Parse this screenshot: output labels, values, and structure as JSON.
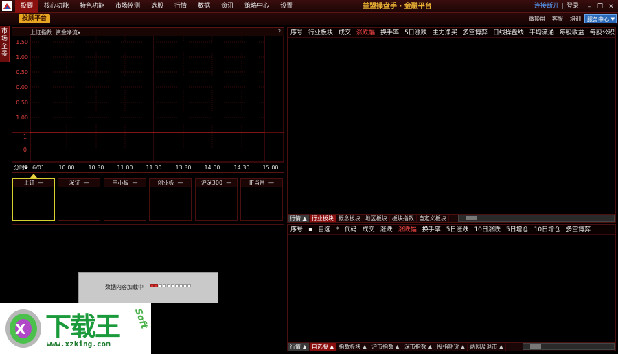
{
  "menu": {
    "items": [
      "投顾",
      "核心功能",
      "特色功能",
      "市场监测",
      "选股",
      "行情",
      "数据",
      "资讯",
      "策略中心",
      "设置"
    ],
    "active_index": 0
  },
  "brand": "益盟操盘手 · 金融平台",
  "top_links": {
    "connect": "连接断开",
    "sep": "|",
    "login": "登录"
  },
  "window_buttons": {
    "minimize": "–",
    "restore": "❐",
    "close": "✕"
  },
  "subbar": {
    "tab": "投顾平台",
    "links": [
      "微操盘",
      "客服",
      "培训"
    ],
    "service": "服务中心",
    "service_arrow": "▼"
  },
  "vertical_label": "市场全景",
  "chart_panel": {
    "index_name": "上证指数",
    "flow_selector": "资金净流▾",
    "help": "?",
    "period_label": "分时",
    "date": "6/01",
    "time_ticks": [
      "10:00",
      "10:30",
      "11:00",
      "11:30",
      "13:30",
      "14:00",
      "14:30",
      "15:00"
    ],
    "y_ticks_upper": [
      "1.50",
      "1.00",
      "0.50",
      "0.00",
      "0.50",
      "1.00"
    ],
    "y_ticks_lower": [
      "1",
      "0"
    ]
  },
  "chart_data": {
    "type": "line",
    "title": "",
    "series": [],
    "xlabel": "",
    "ylabel": "",
    "categories": [
      "6/01",
      "10:00",
      "10:30",
      "11:00",
      "11:30",
      "13:30",
      "14:00",
      "14:30",
      "15:00"
    ]
  },
  "index_boxes": [
    {
      "name": "上证",
      "value": "—"
    },
    {
      "name": "深证",
      "value": "—"
    },
    {
      "name": "中小板",
      "value": "—"
    },
    {
      "name": "创业板",
      "value": "—"
    },
    {
      "name": "沪深300",
      "value": "—"
    },
    {
      "name": "IF当月",
      "value": "—"
    }
  ],
  "loading": {
    "text": "数据内容加载中",
    "progress_fraction": 0.2
  },
  "right_top": {
    "columns": [
      "序号",
      "行业板块",
      "成交",
      "涨跌幅",
      "换手率",
      "5日涨跌",
      "主力净买",
      "多空博弈",
      "日线操盘线",
      "平均流通",
      "每股收益",
      "每股公积金"
    ],
    "sorted_index": 3,
    "tabs": [
      "行情 ▲",
      "行业板块",
      "概念板块",
      "地区板块",
      "板块指数",
      "自定义板块"
    ],
    "active_tab": 1
  },
  "right_bottom": {
    "columns": [
      "序号",
      "▪",
      "自选",
      "*",
      "代码",
      "成交",
      "涨跌",
      "涨跌幅",
      "换手率",
      "5日涨跌",
      "10日涨跌",
      "5日增仓",
      "10日增仓",
      "多空博弈"
    ],
    "sorted_index": 7,
    "tabs": [
      "行情 ▲",
      "自选股 ▲",
      "指数板块 ▲",
      "沪市指数 ▲",
      "深市指数 ▲",
      "股指期货 ▲",
      "两网及退市 ▲"
    ],
    "active_tab": 1
  },
  "watermark": {
    "brand": "下载王",
    "soft": "Soft",
    "url": "www.xzking.com"
  },
  "colors": {
    "accent": "#8a1010",
    "up": "#ff4a4a",
    "brand": "#e8b234",
    "link": "#5aa0ff"
  }
}
